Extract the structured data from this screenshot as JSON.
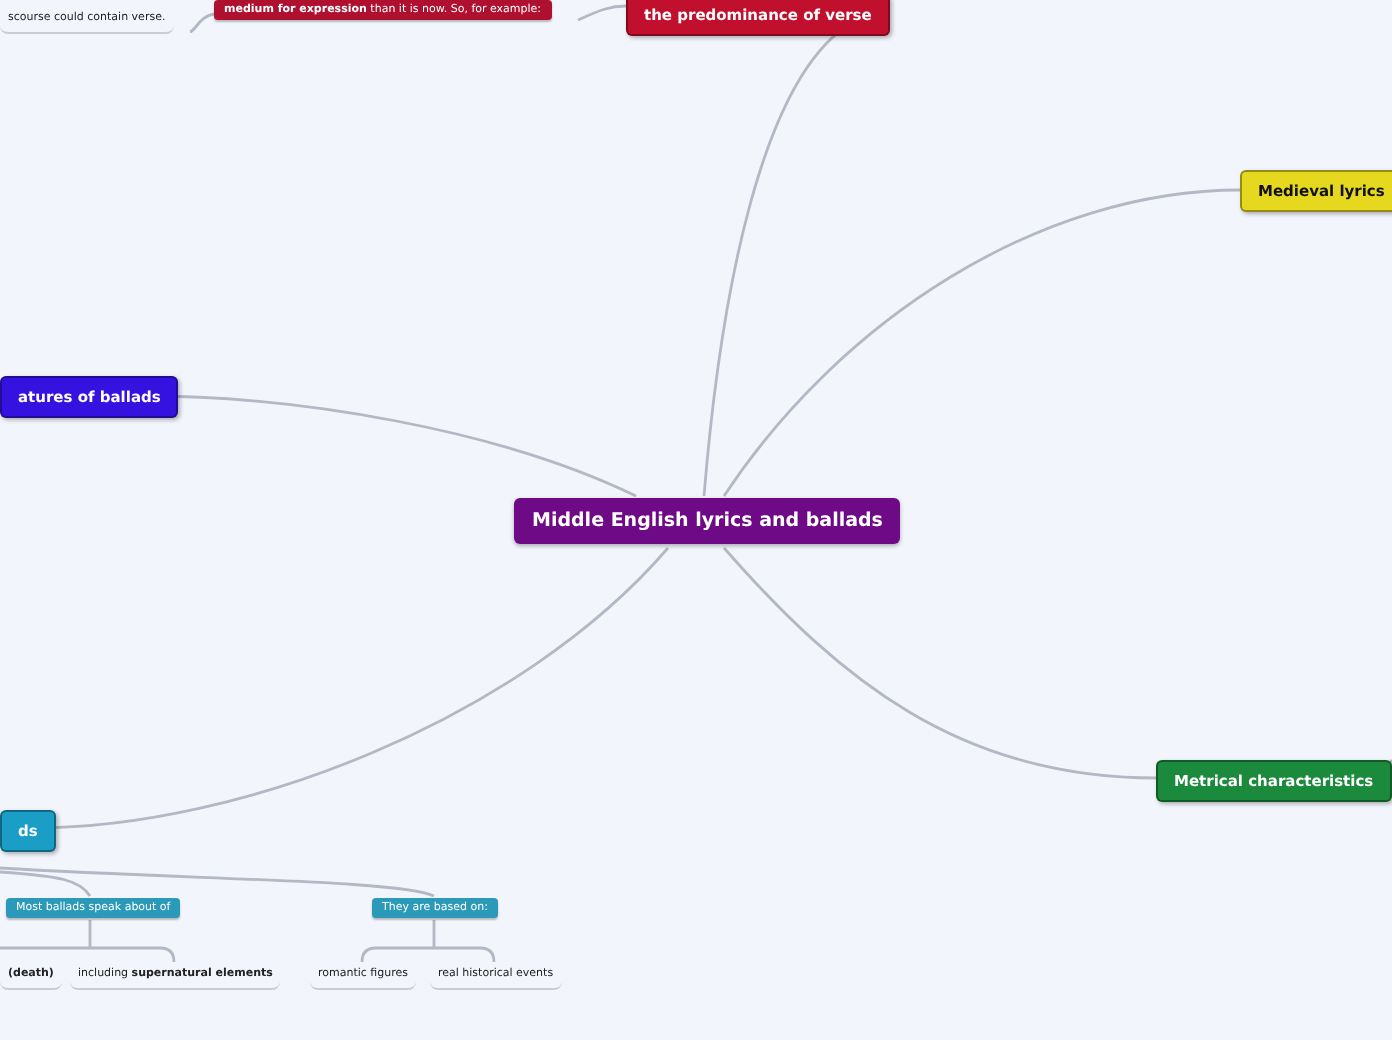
{
  "map": {
    "nodes": [
      {
        "kind": "note",
        "text": "scourse could contain verse."
      },
      {
        "kind": "subtopic",
        "text": "**medium for expression** than it is now. So, for example:",
        "color": "#b01030"
      },
      {
        "kind": "topic",
        "text": "the predominance of verse",
        "color": "#c0102e"
      },
      {
        "kind": "topic",
        "text": "Medieval lyrics",
        "color": "#e6d81e"
      },
      {
        "kind": "topic",
        "text": "atures of ballads",
        "color": "#3612e0"
      },
      {
        "kind": "central",
        "text": "Middle English lyrics and ballads",
        "color": "#6e0a86"
      },
      {
        "kind": "topic",
        "text": "Metrical characteristics",
        "color": "#1b8a3c"
      },
      {
        "kind": "topic",
        "text": "ds",
        "color": "#1a9ec6"
      },
      {
        "kind": "subtopic",
        "text": "Most ballads speak about of",
        "color": "#2a9ab8"
      },
      {
        "kind": "subtopic",
        "text": "They are based on:",
        "color": "#2a9ab8"
      },
      {
        "kind": "note",
        "text": "(death)"
      },
      {
        "kind": "note",
        "text": "including **supernatural elements**"
      },
      {
        "kind": "note",
        "text": "romantic figures"
      },
      {
        "kind": "note",
        "text": "real historical events"
      }
    ]
  }
}
